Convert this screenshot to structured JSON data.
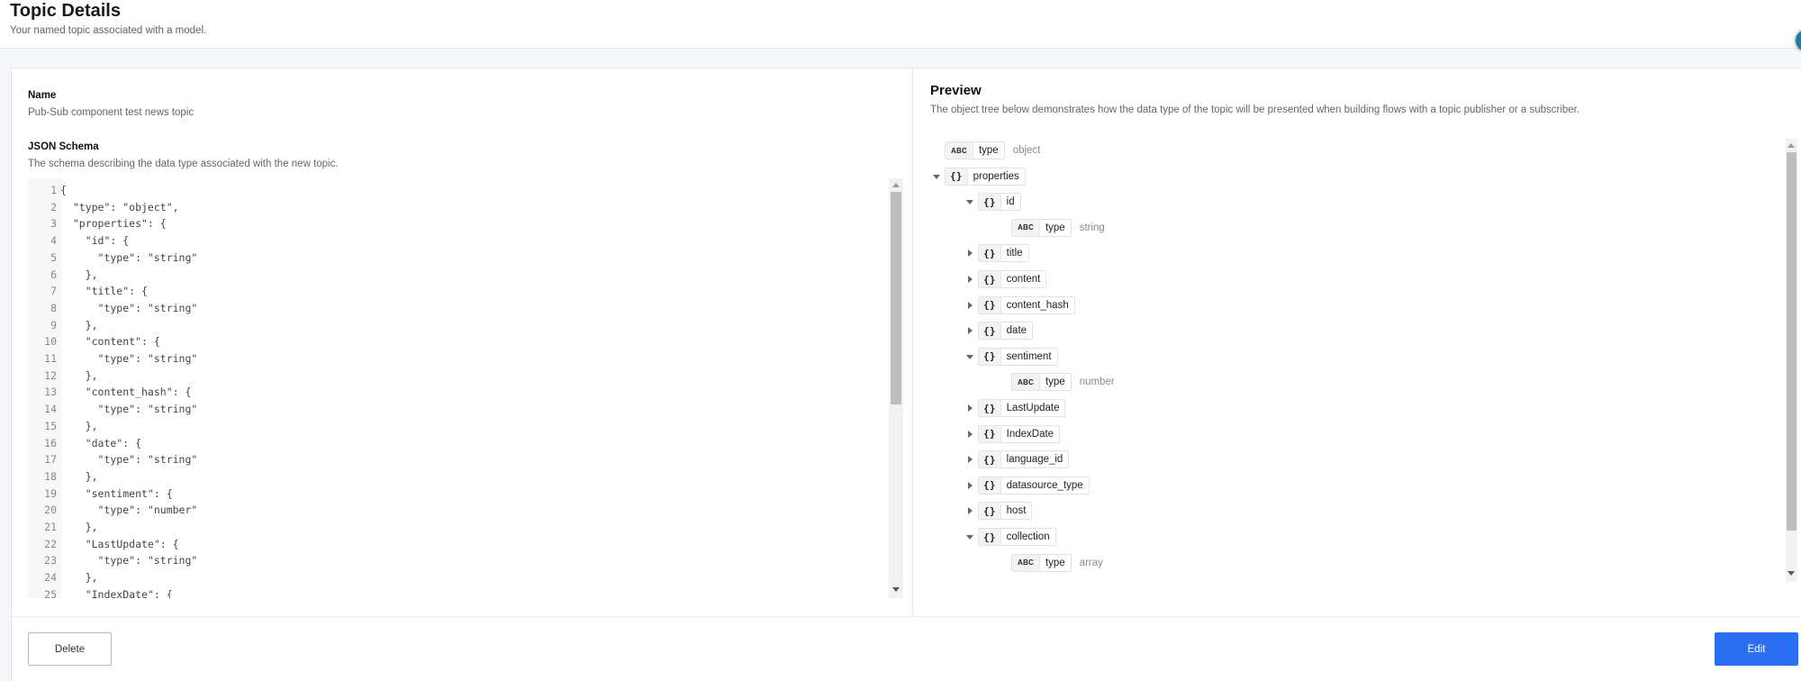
{
  "header": {
    "title": "Topic Details",
    "subtitle": "Your named topic associated with a model."
  },
  "name_field": {
    "label": "Name",
    "value": "Pub-Sub component test news topic"
  },
  "schema_field": {
    "label": "JSON Schema",
    "description": "The schema describing the data type associated with the new topic."
  },
  "code_lines": [
    {
      "n": "1",
      "t": "{"
    },
    {
      "n": "2",
      "t": "  \"type\": \"object\","
    },
    {
      "n": "3",
      "t": "  \"properties\": {"
    },
    {
      "n": "4",
      "t": "    \"id\": {"
    },
    {
      "n": "5",
      "t": "      \"type\": \"string\""
    },
    {
      "n": "6",
      "t": "    },"
    },
    {
      "n": "7",
      "t": "    \"title\": {"
    },
    {
      "n": "8",
      "t": "      \"type\": \"string\""
    },
    {
      "n": "9",
      "t": "    },"
    },
    {
      "n": "10",
      "t": "    \"content\": {"
    },
    {
      "n": "11",
      "t": "      \"type\": \"string\""
    },
    {
      "n": "12",
      "t": "    },"
    },
    {
      "n": "13",
      "t": "    \"content_hash\": {"
    },
    {
      "n": "14",
      "t": "      \"type\": \"string\""
    },
    {
      "n": "15",
      "t": "    },"
    },
    {
      "n": "16",
      "t": "    \"date\": {"
    },
    {
      "n": "17",
      "t": "      \"type\": \"string\""
    },
    {
      "n": "18",
      "t": "    },"
    },
    {
      "n": "19",
      "t": "    \"sentiment\": {"
    },
    {
      "n": "20",
      "t": "      \"type\": \"number\""
    },
    {
      "n": "21",
      "t": "    },"
    },
    {
      "n": "22",
      "t": "    \"LastUpdate\": {"
    },
    {
      "n": "23",
      "t": "      \"type\": \"string\""
    },
    {
      "n": "24",
      "t": "    },"
    },
    {
      "n": "25",
      "t": "    \"IndexDate\": {"
    }
  ],
  "preview": {
    "title": "Preview",
    "description": "The object tree below demonstrates how the data type of the topic will be presented when building flows with a topic publisher or a subscriber.",
    "tree": [
      {
        "depth": 0,
        "kind": "abc",
        "icon": "ABC",
        "label": "type",
        "value": "object",
        "caret": "none"
      },
      {
        "depth": 0,
        "kind": "obj",
        "icon": "{}",
        "label": "properties",
        "value": "",
        "caret": "down"
      },
      {
        "depth": 1,
        "kind": "obj",
        "icon": "{}",
        "label": "id",
        "value": "",
        "caret": "down"
      },
      {
        "depth": 2,
        "kind": "abc",
        "icon": "ABC",
        "label": "type",
        "value": "string",
        "caret": "none"
      },
      {
        "depth": 1,
        "kind": "obj",
        "icon": "{}",
        "label": "title",
        "value": "",
        "caret": "right"
      },
      {
        "depth": 1,
        "kind": "obj",
        "icon": "{}",
        "label": "content",
        "value": "",
        "caret": "right"
      },
      {
        "depth": 1,
        "kind": "obj",
        "icon": "{}",
        "label": "content_hash",
        "value": "",
        "caret": "right"
      },
      {
        "depth": 1,
        "kind": "obj",
        "icon": "{}",
        "label": "date",
        "value": "",
        "caret": "right"
      },
      {
        "depth": 1,
        "kind": "obj",
        "icon": "{}",
        "label": "sentiment",
        "value": "",
        "caret": "down"
      },
      {
        "depth": 2,
        "kind": "abc",
        "icon": "ABC",
        "label": "type",
        "value": "number",
        "caret": "none"
      },
      {
        "depth": 1,
        "kind": "obj",
        "icon": "{}",
        "label": "LastUpdate",
        "value": "",
        "caret": "right"
      },
      {
        "depth": 1,
        "kind": "obj",
        "icon": "{}",
        "label": "IndexDate",
        "value": "",
        "caret": "right"
      },
      {
        "depth": 1,
        "kind": "obj",
        "icon": "{}",
        "label": "language_id",
        "value": "",
        "caret": "right"
      },
      {
        "depth": 1,
        "kind": "obj",
        "icon": "{}",
        "label": "datasource_type",
        "value": "",
        "caret": "right"
      },
      {
        "depth": 1,
        "kind": "obj",
        "icon": "{}",
        "label": "host",
        "value": "",
        "caret": "right"
      },
      {
        "depth": 1,
        "kind": "obj",
        "icon": "{}",
        "label": "collection",
        "value": "",
        "caret": "down"
      },
      {
        "depth": 2,
        "kind": "abc",
        "icon": "ABC",
        "label": "type",
        "value": "array",
        "caret": "none"
      }
    ]
  },
  "footer": {
    "delete_label": "Delete",
    "edit_label": "Edit"
  },
  "colors": {
    "primary": "#2a6ff2",
    "avatar": "#1a7ea6"
  }
}
